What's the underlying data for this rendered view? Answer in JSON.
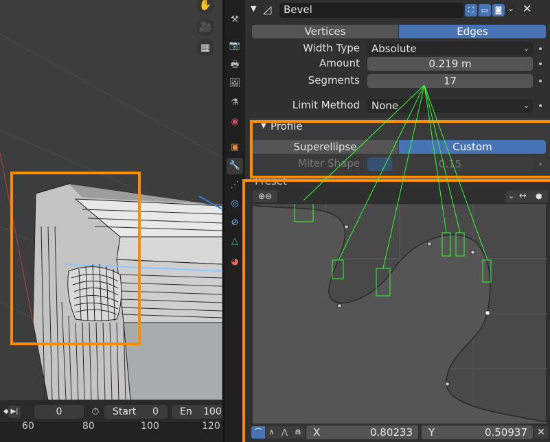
{
  "viewport": {
    "nav_icons": [
      "hand-pan-icon",
      "camera-icon",
      "grid-icon"
    ]
  },
  "timeline": {
    "current_frame": "0",
    "start_label": "Start",
    "start_value": "0",
    "end_label": "En",
    "end_value": "100",
    "frame_numbers": [
      "60",
      "80",
      "100",
      "120"
    ]
  },
  "modifier": {
    "name": "Bevel",
    "affect_options": [
      "Vertices",
      "Edges"
    ],
    "affect_selected": "Edges",
    "width_type_label": "Width Type",
    "width_type_value": "Absolute",
    "amount_label": "Amount",
    "amount_value": "0.219 m",
    "segments_label": "Segments",
    "segments_value": "17",
    "limit_method_label": "Limit Method",
    "limit_method_value": "None"
  },
  "profile": {
    "section_label": "Profile",
    "type_options": [
      "Superellipse",
      "Custom"
    ],
    "type_selected": "Custom",
    "miter_shape_label": "Miter Shape",
    "miter_shape_value": "0.15",
    "miter_shape_fraction": 0.15,
    "preset_label": "Preset",
    "x_label": "X",
    "x_value": "0.80233",
    "y_label": "Y",
    "y_value": "0.50937"
  },
  "colors": {
    "accent_blue": "#4772b3",
    "highlight_orange": "#ff8c00",
    "annotation_green": "#33ff33"
  }
}
